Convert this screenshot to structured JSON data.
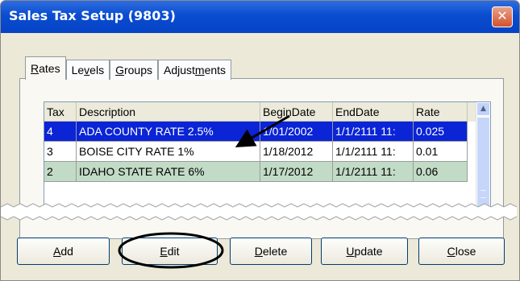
{
  "window": {
    "title": "Sales Tax Setup (9803)",
    "close_glyph": "✕"
  },
  "tabs": [
    {
      "prefix": "",
      "accel": "R",
      "suffix": "ates"
    },
    {
      "prefix": "Le",
      "accel": "v",
      "suffix": "els"
    },
    {
      "prefix": "",
      "accel": "G",
      "suffix": "roups"
    },
    {
      "prefix": "Adjust",
      "accel": "m",
      "suffix": "ents"
    }
  ],
  "grid": {
    "columns": [
      "Tax",
      "Description",
      "BeginDate",
      "EndDate",
      "Rate"
    ],
    "rows": [
      {
        "tax": "4",
        "description": "ADA COUNTY RATE 2.5%",
        "begin": "1/01/2002",
        "end": "1/1/2111 11:",
        "rate": "0.025",
        "state": "selected"
      },
      {
        "tax": "3",
        "description": "BOISE CITY RATE 1%",
        "begin": "1/18/2012",
        "end": "1/1/2111 11:",
        "rate": "0.01",
        "state": "normal"
      },
      {
        "tax": "2",
        "description": "IDAHO STATE RATE 6%",
        "begin": "1/17/2012",
        "end": "1/1/2111 11:",
        "rate": "0.06",
        "state": "alt"
      }
    ],
    "scroll_up_glyph": "▲"
  },
  "buttons": [
    {
      "prefix": "",
      "accel": "A",
      "suffix": "dd"
    },
    {
      "prefix": "",
      "accel": "E",
      "suffix": "dit"
    },
    {
      "prefix": "",
      "accel": "D",
      "suffix": "elete"
    },
    {
      "prefix": "",
      "accel": "U",
      "suffix": "pdate"
    },
    {
      "prefix": "",
      "accel": "C",
      "suffix": "lose"
    }
  ],
  "colors": {
    "selected_row": "#0a24d6",
    "alt_row": "#c1dbc6",
    "title_bar": "#0a4cd0",
    "callout": "#000000"
  }
}
